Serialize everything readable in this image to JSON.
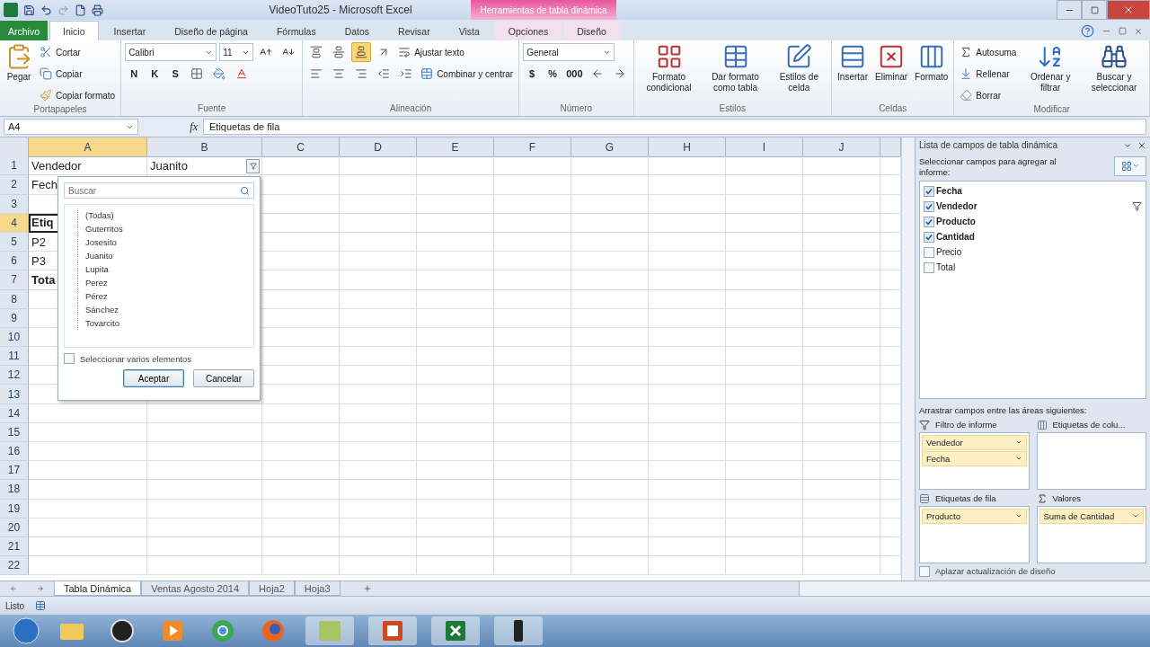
{
  "window": {
    "title": "VideoTuto25  -  Microsoft Excel",
    "context_title": "Herramientas de tabla dinámica"
  },
  "menu_tabs": [
    {
      "label": "Archivo",
      "kind": "file",
      "selected": false
    },
    {
      "label": "Inicio",
      "kind": "tab",
      "selected": true
    },
    {
      "label": "Insertar",
      "kind": "tab",
      "selected": false
    },
    {
      "label": "Diseño de página",
      "kind": "tab",
      "selected": false
    },
    {
      "label": "Fórmulas",
      "kind": "tab",
      "selected": false
    },
    {
      "label": "Datos",
      "kind": "tab",
      "selected": false
    },
    {
      "label": "Revisar",
      "kind": "tab",
      "selected": false
    },
    {
      "label": "Vista",
      "kind": "tab",
      "selected": false
    },
    {
      "label": "Opciones",
      "kind": "context",
      "selected": false
    },
    {
      "label": "Diseño",
      "kind": "context",
      "selected": false
    }
  ],
  "ribbon": [
    {
      "title": "Portapapeles",
      "parts": [
        {
          "kind": "large",
          "label": "Pegar"
        },
        {
          "kind": "stack",
          "rows": [
            [
              {
                "kind": "small",
                "label": "Cortar"
              }
            ],
            [
              {
                "kind": "small",
                "label": "Copiar"
              }
            ],
            [
              {
                "kind": "small",
                "label": "Copiar formato"
              }
            ]
          ]
        }
      ]
    },
    {
      "title": "Fuente",
      "parts": [
        {
          "kind": "stack",
          "rows": [
            [
              {
                "kind": "combo",
                "label": "Calibri"
              },
              {
                "kind": "combo",
                "label": "11"
              },
              {
                "kind": "icon"
              },
              {
                "kind": "icon"
              }
            ],
            [
              {
                "kind": "glyph",
                "label": "N"
              },
              {
                "kind": "glyph",
                "label": "K"
              },
              {
                "kind": "glyph",
                "label": "S"
              },
              {
                "kind": "icon"
              },
              {
                "kind": "icon"
              },
              {
                "kind": "icon"
              }
            ]
          ]
        }
      ]
    },
    {
      "title": "Alineación",
      "parts": [
        {
          "kind": "stack",
          "rows": [
            [
              {
                "kind": "icon",
                "on": false
              },
              {
                "kind": "icon",
                "on": false
              },
              {
                "kind": "icon",
                "on": true
              },
              {
                "kind": "icon",
                "on": false
              },
              {
                "kind": "small",
                "label": "Ajustar texto"
              }
            ],
            [
              {
                "kind": "icon",
                "on": false
              },
              {
                "kind": "icon",
                "on": false
              },
              {
                "kind": "icon",
                "on": false
              },
              {
                "kind": "icon",
                "on": false
              },
              {
                "kind": "icon",
                "on": false
              },
              {
                "kind": "small",
                "label": "Combinar y centrar"
              }
            ]
          ]
        }
      ]
    },
    {
      "title": "Número",
      "parts": [
        {
          "kind": "stack",
          "rows": [
            [
              {
                "kind": "combo",
                "label": "General"
              }
            ],
            [
              {
                "kind": "glyph",
                "label": "$"
              },
              {
                "kind": "glyph",
                "label": "%"
              },
              {
                "kind": "glyph",
                "label": "000"
              },
              {
                "kind": "icon"
              },
              {
                "kind": "icon"
              }
            ]
          ]
        }
      ]
    },
    {
      "title": "Estilos",
      "parts": [
        {
          "kind": "large",
          "label": "Formato condicional"
        },
        {
          "kind": "large",
          "label": "Dar formato como tabla"
        },
        {
          "kind": "large",
          "label": "Estilos de celda"
        }
      ]
    },
    {
      "title": "Celdas",
      "parts": [
        {
          "kind": "large",
          "label": "Insertar"
        },
        {
          "kind": "large",
          "label": "Eliminar"
        },
        {
          "kind": "large",
          "label": "Formato"
        }
      ]
    },
    {
      "title": "Modificar",
      "parts": [
        {
          "kind": "stack",
          "rows": [
            [
              {
                "kind": "small",
                "label": "Autosuma"
              }
            ],
            [
              {
                "kind": "small",
                "label": "Rellenar"
              }
            ],
            [
              {
                "kind": "small",
                "label": "Borrar"
              }
            ]
          ]
        },
        {
          "kind": "large",
          "label": "Ordenar y filtrar"
        },
        {
          "kind": "large",
          "label": "Buscar y seleccionar"
        }
      ]
    }
  ],
  "formula_bar": {
    "name_box": "A4",
    "function_label": "fx",
    "value": "Etiquetas de fila"
  },
  "columns": [
    {
      "label": "A",
      "selected": true
    },
    {
      "label": "B",
      "selected": false
    },
    {
      "label": "C",
      "selected": false
    },
    {
      "label": "D",
      "selected": false
    },
    {
      "label": "E",
      "selected": false
    },
    {
      "label": "F",
      "selected": false
    },
    {
      "label": "G",
      "selected": false
    },
    {
      "label": "H",
      "selected": false
    },
    {
      "label": "I",
      "selected": false
    },
    {
      "label": "J",
      "selected": false
    }
  ],
  "rows": [
    {
      "number": "1",
      "selected": false,
      "cells": [
        {
          "text": "Vendedor",
          "bold": false,
          "active": false,
          "filter_button": false
        },
        {
          "text": "Juanito",
          "bold": false,
          "active": false,
          "filter_button": true
        }
      ]
    },
    {
      "number": "2",
      "selected": false,
      "cells": [
        {
          "text": "Fech",
          "bold": false,
          "active": false,
          "filter_button": false
        }
      ]
    },
    {
      "number": "3",
      "selected": false
    },
    {
      "number": "4",
      "selected": true,
      "cells": [
        {
          "text": "Etiq",
          "bold": true,
          "active": true,
          "filter_button": false
        }
      ]
    },
    {
      "number": "5",
      "selected": false,
      "cells": [
        {
          "text": "P2",
          "bold": false,
          "active": false,
          "filter_button": false
        }
      ]
    },
    {
      "number": "6",
      "selected": false,
      "cells": [
        {
          "text": "P3",
          "bold": false,
          "active": false,
          "filter_button": false
        }
      ]
    },
    {
      "number": "7",
      "selected": false,
      "cells": [
        {
          "text": "Tota",
          "bold": true,
          "active": false,
          "filter_button": false
        }
      ]
    },
    {
      "number": "8",
      "selected": false
    },
    {
      "number": "9",
      "selected": false
    },
    {
      "number": "10",
      "selected": false
    },
    {
      "number": "11",
      "selected": false
    },
    {
      "number": "12",
      "selected": false
    },
    {
      "number": "13",
      "selected": false
    },
    {
      "number": "14",
      "selected": false
    },
    {
      "number": "15",
      "selected": false
    },
    {
      "number": "16",
      "selected": false
    },
    {
      "number": "17",
      "selected": false
    },
    {
      "number": "18",
      "selected": false
    },
    {
      "number": "19",
      "selected": false
    },
    {
      "number": "20",
      "selected": false
    },
    {
      "number": "21",
      "selected": false
    },
    {
      "number": "22",
      "selected": false
    }
  ],
  "filter_popup": {
    "search": {
      "placeholder": "Buscar"
    },
    "items": [
      "(Todas)",
      "Guterritos",
      "Josesito",
      "Juanito",
      "Lupita",
      "Perez",
      "Pérez",
      "Sánchez",
      "Tovarcito"
    ],
    "multi_select": {
      "label": "Seleccionar varios elementos",
      "checked": false
    },
    "buttons": [
      {
        "label": "Aceptar",
        "default": true
      },
      {
        "label": "Cancelar",
        "default": false
      }
    ]
  },
  "field_list": {
    "title": "Lista de campos de tabla dinámica",
    "instruction": "Seleccionar campos para agregar al informe:",
    "fields": [
      {
        "label": "Fecha",
        "checked": true,
        "filtered": false
      },
      {
        "label": "Vendedor",
        "checked": true,
        "filtered": true
      },
      {
        "label": "Producto",
        "checked": true,
        "filtered": false
      },
      {
        "label": "Cantidad",
        "checked": true,
        "filtered": false
      },
      {
        "label": "Precio",
        "checked": false,
        "filtered": false
      },
      {
        "label": "Total",
        "checked": false,
        "filtered": false
      }
    ],
    "areas_label": "Arrastrar campos entre las áreas siguientes:",
    "areas": [
      {
        "kind": "filter",
        "title": "Filtro de informe",
        "items": [
          "Vendedor",
          "Fecha"
        ]
      },
      {
        "kind": "columns",
        "title": "Etiquetas de colu..."
      },
      {
        "kind": "rows",
        "title": "Etiquetas de fila",
        "items": [
          "Producto"
        ]
      },
      {
        "kind": "values",
        "title": "Valores",
        "items": [
          "Suma de Cantidad"
        ]
      }
    ],
    "defer": {
      "label": "Aplazar actualización de diseño",
      "checked": false
    }
  },
  "sheet_tabs": [
    {
      "label": "Tabla Dinámica",
      "selected": true
    },
    {
      "label": "Ventas Agosto 2014",
      "selected": false
    },
    {
      "label": "Hoja2",
      "selected": false
    },
    {
      "label": "Hoja3",
      "selected": false
    }
  ],
  "status_bar": {
    "text": "Listo"
  }
}
